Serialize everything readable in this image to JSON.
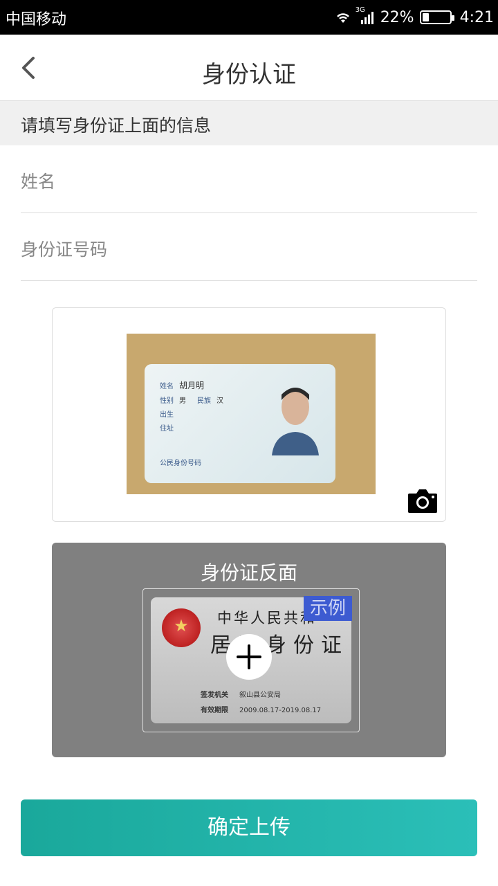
{
  "status_bar": {
    "carrier": "中国移动",
    "network": "3G",
    "battery_percent": "22%",
    "battery_level": 0.22,
    "time": "4:21"
  },
  "nav": {
    "title": "身份认证",
    "back_icon": "chevron-left-icon"
  },
  "section": {
    "header": "请填写身份证上面的信息"
  },
  "form": {
    "name_placeholder": "姓名",
    "name_value": "",
    "id_placeholder": "身份证号码",
    "id_value": ""
  },
  "front_card": {
    "photo": {
      "name_label": "姓名",
      "name_value": "胡月明",
      "gender_label": "性别",
      "gender_value": "男",
      "ethnicity_label": "民族",
      "ethnicity_value": "汉",
      "birth_label": "出生",
      "address_label": "住址",
      "id_label": "公民身份号码"
    },
    "camera_icon": "camera-icon"
  },
  "back_card": {
    "title": "身份证反面",
    "sample_badge": "示例",
    "sample": {
      "heading": "中华人民共和",
      "subheading": "居民身份证",
      "authority_label": "签发机关",
      "authority_value": "叙山县公安局",
      "validity_label": "有效期限",
      "validity_value": "2009.08.17-2019.08.17"
    },
    "add_icon": "plus-icon"
  },
  "submit": {
    "label": "确定上传"
  },
  "colors": {
    "accent": "#22b3aa",
    "back_card_bg": "#808080",
    "section_bg": "#f0f0f0",
    "sample_badge": "#3d5bd1"
  }
}
